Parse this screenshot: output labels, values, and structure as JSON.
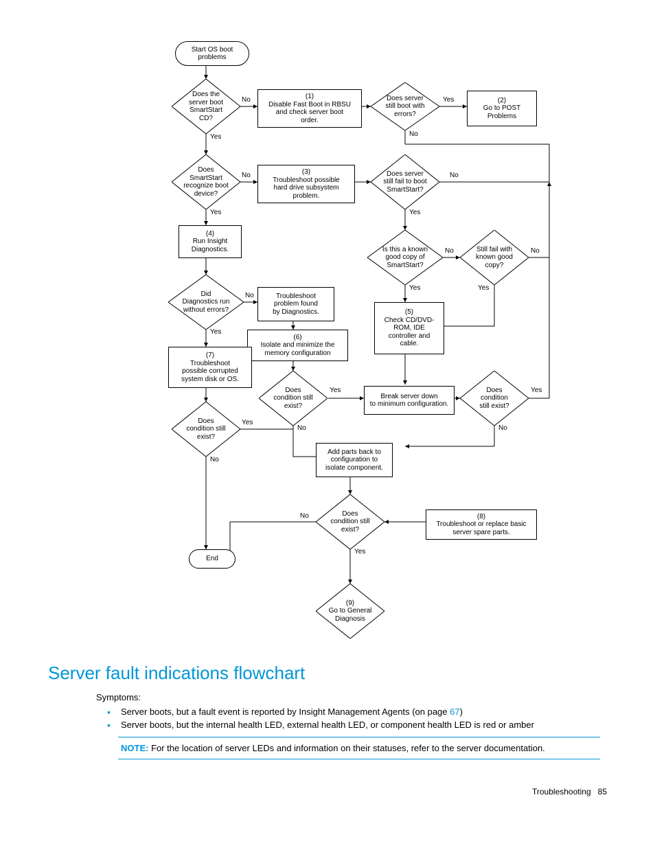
{
  "flow": {
    "start": "Start OS boot\nproblems",
    "d1": "Does the\nserver boot\nSmartStart\nCD?",
    "p1": "(1)\nDisable Fast Boot in RBSU\nand check server boot\norder.",
    "d2": "Does server\nstill boot with\nerrors?",
    "p2": "(2)\nGo to POST\nProblems",
    "d3": "Does\nSmartStart\nrecognize boot\ndevice?",
    "p3": "(3)\nTroubleshoot possible\nhard drive subsystem\nproblem.",
    "d4": "Does server\nstill fail to boot\nSmartStart?",
    "p4": "(4)\nRun Insight\nDiagnostics.",
    "d5": "Is this a known\ngood copy of\nSmartStart?",
    "d6": "Still fail with\nknown good\ncopy?",
    "d7": "Did\nDiagnostics run\nwithout errors?",
    "p5": "Troubleshoot\nproblem found\nby Diagnostics.",
    "p6": "(6)\nIsolate and minimize the\nmemory configuration",
    "p7check": "(5)\nCheck CD/DVD-\nROM, IDE\ncontroller and\ncable.",
    "p7": "(7)\nTroubleshoot\npossible corrupted\nsystem disk or OS.",
    "d8": "Does\ncondition still\nexist?",
    "d9": "Does\ncondition still\nexist?",
    "p8break": "Break server down\nto minimum configuration.",
    "d10": "Does\ncondition\nstill exist?",
    "p8add": "Add parts back to\nconfiguration to\nisolate component.",
    "d11": "Does\ncondition still\nexist?",
    "p8": "(8)\nTroubleshoot or replace basic\nserver spare parts.",
    "p9": "(9)\nGo to General\nDiagnosis",
    "end": "End",
    "yes": "Yes",
    "no": "No"
  },
  "heading": "Server fault indications flowchart",
  "symptoms_label": "Symptoms:",
  "bullets": [
    {
      "pre": "Server boots, but a fault event is reported by Insight Management Agents (on page ",
      "link": "67",
      "post": ")"
    },
    {
      "pre": "Server boots, but the internal health LED, external health LED, or component health LED is red or amber",
      "link": "",
      "post": ""
    }
  ],
  "note_label": "NOTE:",
  "note_text": "  For the location of server LEDs and information on their statuses, refer to the server documentation.",
  "footer_section": "Troubleshooting",
  "footer_page": "85"
}
